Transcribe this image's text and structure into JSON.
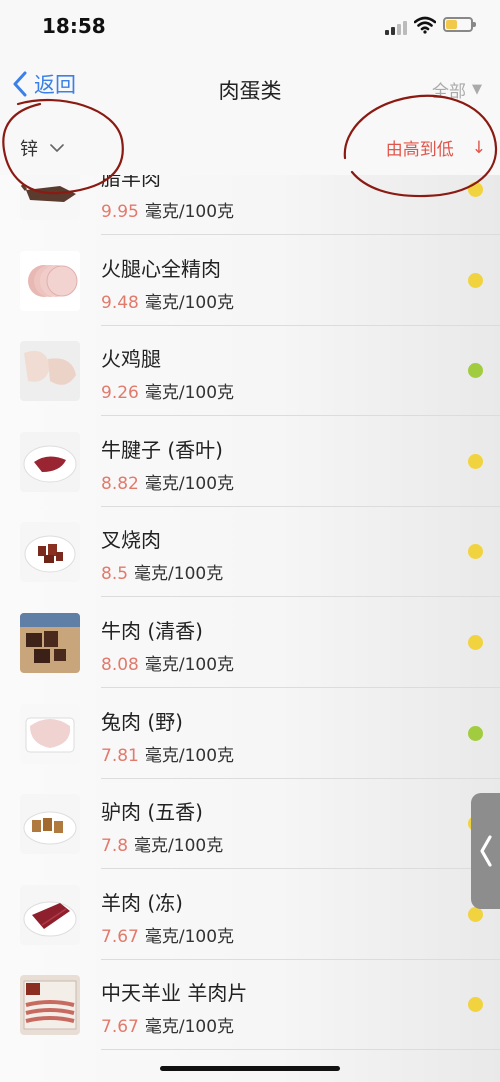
{
  "status_bar": {
    "time": "18:58"
  },
  "nav": {
    "back_label": "返回",
    "title": "肉蛋类",
    "filter_label": "全部",
    "filter_arrow": "▼"
  },
  "sort": {
    "nutrient": "锌",
    "order_label": "由高到低",
    "order_arrow": "↓"
  },
  "colors": {
    "accent_blue": "#3a80e8",
    "accent_red": "#e0564b",
    "value_red": "#e27a6c",
    "dot_yellow": "#f1d33f",
    "dot_green": "#a2cc3f",
    "annotation": "#8a1a12"
  },
  "items": [
    {
      "name": "腊羊肉",
      "value": "9.95",
      "unit": "毫克/100克",
      "level": "yellow",
      "thumb": "cured-mutton"
    },
    {
      "name": "火腿心全精肉",
      "value": "9.48",
      "unit": "毫克/100克",
      "level": "yellow",
      "thumb": "ham-slices"
    },
    {
      "name": "火鸡腿",
      "value": "9.26",
      "unit": "毫克/100克",
      "level": "green",
      "thumb": "turkey-leg"
    },
    {
      "name": "牛腱子 (香叶)",
      "value": "8.82",
      "unit": "毫克/100克",
      "level": "yellow",
      "thumb": "beef-shank"
    },
    {
      "name": "叉烧肉",
      "value": "8.5",
      "unit": "毫克/100克",
      "level": "yellow",
      "thumb": "char-siu"
    },
    {
      "name": "牛肉 (清香)",
      "value": "8.08",
      "unit": "毫克/100克",
      "level": "yellow",
      "thumb": "beef-cubes"
    },
    {
      "name": "兔肉 (野)",
      "value": "7.81",
      "unit": "毫克/100克",
      "level": "green",
      "thumb": "rabbit-meat"
    },
    {
      "name": "驴肉 (五香)",
      "value": "7.8",
      "unit": "毫克/100克",
      "level": "yellow",
      "thumb": "donkey-meat"
    },
    {
      "name": "羊肉 (冻)",
      "value": "7.67",
      "unit": "毫克/100克",
      "level": "yellow",
      "thumb": "frozen-mutton"
    },
    {
      "name": "中天羊业 羊肉片",
      "value": "7.67",
      "unit": "毫克/100克",
      "level": "yellow",
      "thumb": "mutton-slices-pack"
    }
  ]
}
